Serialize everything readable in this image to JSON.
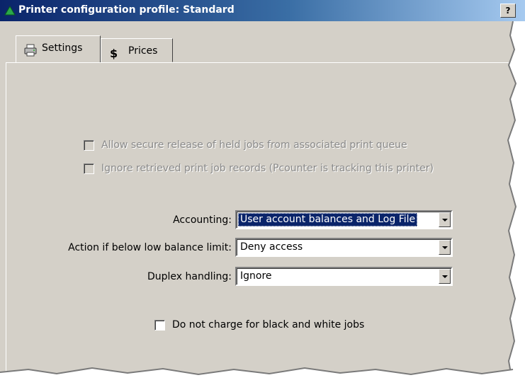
{
  "window": {
    "title": "Printer configuration profile: Standard",
    "help_label": "?"
  },
  "tabs": [
    {
      "label": "Settings",
      "icon": "printer-icon",
      "active": true
    },
    {
      "label": "Prices",
      "icon": "money-icon",
      "active": false
    }
  ],
  "settings": {
    "secure_release": {
      "label": "Allow secure release of held jobs from associated print queue",
      "checked": false,
      "enabled": false
    },
    "ignore_records": {
      "label": "Ignore retrieved print job records (Pcounter is tracking this printer)",
      "checked": false,
      "enabled": false
    },
    "accounting": {
      "label": "Accounting:",
      "value": "User account balances and Log File"
    },
    "low_balance": {
      "label": "Action if below low balance limit:",
      "value": "Deny access"
    },
    "duplex": {
      "label": "Duplex handling:",
      "value": "Ignore"
    },
    "no_charge_bw": {
      "label": "Do not charge for black and white jobs",
      "checked": false,
      "enabled": true
    }
  },
  "colors": {
    "title_bar": "#0a246a",
    "dialog_face": "#d4d0c8",
    "selection": "#0a246a",
    "disabled_text": "#8a8a8a"
  }
}
